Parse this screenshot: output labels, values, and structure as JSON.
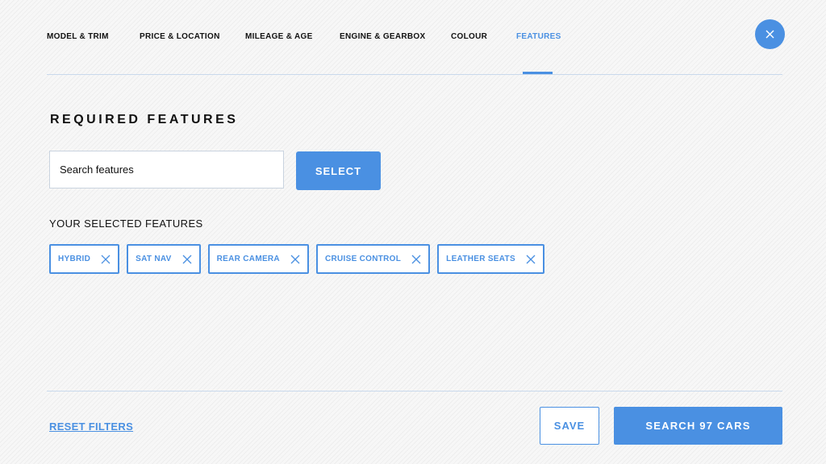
{
  "tabs": [
    {
      "label": "MODEL & TRIM",
      "active": false
    },
    {
      "label": "PRICE & LOCATION",
      "active": false
    },
    {
      "label": "MILEAGE & AGE",
      "active": false
    },
    {
      "label": "ENGINE & GEARBOX",
      "active": false
    },
    {
      "label": "COLOUR",
      "active": false
    },
    {
      "label": "FEATURES",
      "active": true
    }
  ],
  "close": {
    "icon": "close-icon"
  },
  "section": {
    "title": "REQUIRED FEATURES"
  },
  "search": {
    "placeholder": "Search features",
    "value": ""
  },
  "select_button": {
    "label": "SELECT"
  },
  "selected": {
    "heading": "YOUR SELECTED FEATURES",
    "chips": [
      {
        "label": "HYBRID"
      },
      {
        "label": "SAT NAV"
      },
      {
        "label": "REAR CAMERA"
      },
      {
        "label": "CRUISE CONTROL"
      },
      {
        "label": "LEATHER SEATS"
      }
    ]
  },
  "footer": {
    "reset_label": "RESET FILTERS",
    "save_label": "SAVE",
    "search_label": "SEARCH 97 CARS"
  },
  "colors": {
    "accent": "#4a90e2",
    "text": "#111111",
    "divider": "#c9d9ec"
  }
}
